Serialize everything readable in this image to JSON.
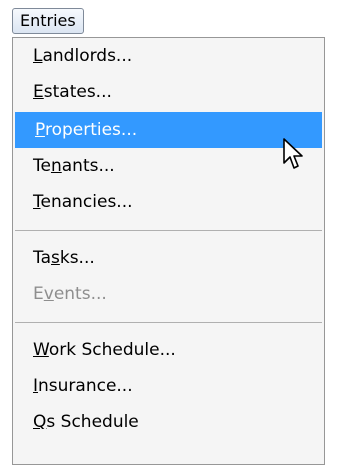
{
  "menubar": {
    "entries_label": "Entries"
  },
  "menu": {
    "items": [
      {
        "pre": "",
        "accel": "L",
        "post": "andlords..."
      },
      {
        "pre": "",
        "accel": "E",
        "post": "states..."
      },
      {
        "pre": "",
        "accel": "P",
        "post": "roperties..."
      },
      {
        "pre": "Te",
        "accel": "n",
        "post": "ants..."
      },
      {
        "pre": "",
        "accel": "T",
        "post": "enancies..."
      },
      {
        "pre": "Ta",
        "accel": "s",
        "post": "ks..."
      },
      {
        "pre": "E",
        "accel": "v",
        "post": "ents..."
      },
      {
        "pre": "",
        "accel": "W",
        "post": "ork Schedule..."
      },
      {
        "pre": "",
        "accel": "I",
        "post": "nsurance..."
      },
      {
        "pre": "",
        "accel": "Q",
        "post": "s Schedule"
      }
    ],
    "highlighted_item": "Properties...",
    "disabled_item": "Events..."
  },
  "cursor": {
    "icon": "mouse-pointer-icon"
  },
  "colors": {
    "highlight": "#3399ff",
    "menu_background": "#f5f5f5",
    "disabled_text": "#8e8e8e"
  }
}
